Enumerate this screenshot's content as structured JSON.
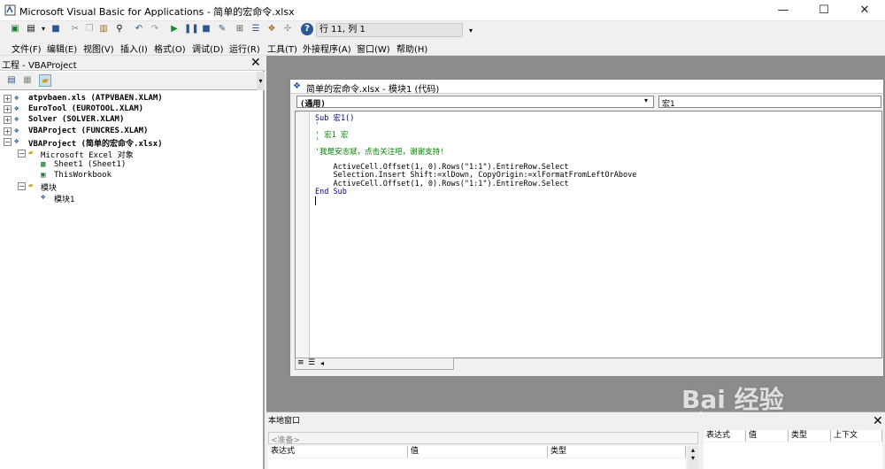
{
  "window": {
    "title": "Microsoft Visual Basic for Applications - 简单的宏命令.xlsx",
    "minimize": "—",
    "maximize": "☐",
    "close": "✕"
  },
  "toolbar": {
    "position": "行 11, 列 1"
  },
  "menu": [
    "文件(F)",
    "编辑(E)",
    "视图(V)",
    "插入(I)",
    "格式(O)",
    "调试(D)",
    "运行(R)",
    "工具(T)",
    "外接程序(A)",
    "窗口(W)",
    "帮助(H)"
  ],
  "project": {
    "title": "工程 - VBAProject",
    "items": [
      "atpvbaen.xls (ATPVBAEN.XLAM)",
      "EuroTool (EUROTOOL.XLAM)",
      "Solver (SOLVER.XLAM)",
      "VBAProject (FUNCRES.XLAM)",
      "VBAProject (简单的宏命令.xlsx)",
      "Microsoft Excel 对象",
      "Sheet1 (Sheet1)",
      "ThisWorkbook",
      "模块",
      "模块1"
    ]
  },
  "codewin": {
    "title": "简单的宏命令.xlsx - 模块1 (代码)",
    "object": "(通用)",
    "proc": "宏1",
    "lines": [
      "Sub 宏1()",
      "'",
      "' 宏1 宏",
      "'",
      "'我是安志斌，点击关注吧，谢谢支持!",
      "",
      "    ActiveCell.Offset(1, 0).Rows(\"1:1\").EntireRow.Select",
      "    Selection.Insert Shift:=xlDown, CopyOrigin:=xlFormatFromLeftOrAbove",
      "    ActiveCell.Offset(1, 0).Rows(\"1:1\").EntireRow.Select",
      "End Sub"
    ]
  },
  "locals": {
    "title": "本地窗口",
    "status": "<准备>",
    "cols": [
      "表达式",
      "值",
      "类型"
    ]
  },
  "watch": {
    "cols": [
      "表达式",
      "值",
      "类型",
      "上下文"
    ]
  },
  "watermark": "Bai 经验"
}
